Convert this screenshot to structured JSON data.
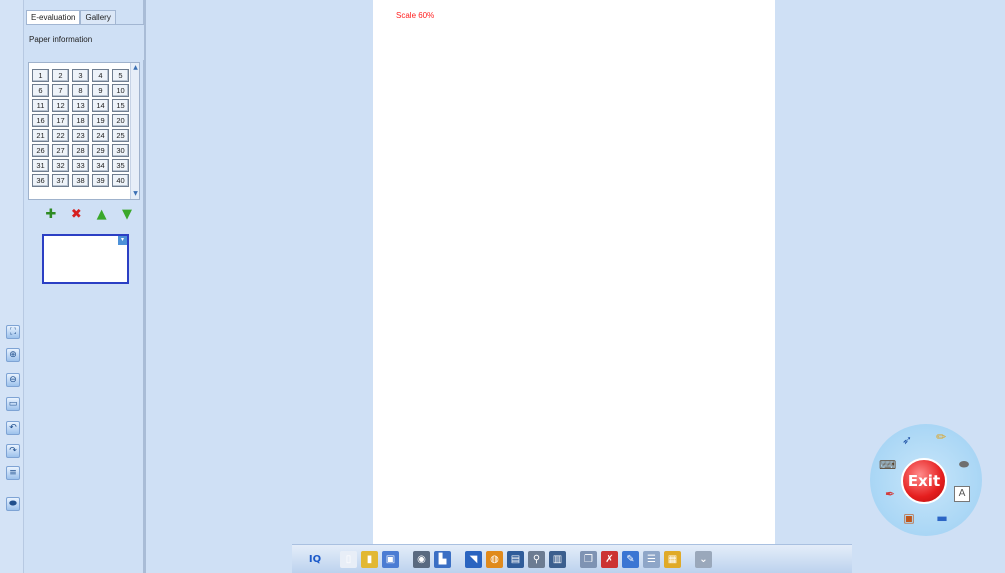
{
  "side_panel": {
    "tabs": [
      {
        "label": "E-evaluation",
        "active": true
      },
      {
        "label": "Gallery",
        "active": false
      }
    ],
    "paper_information_label": "Paper information",
    "pages": [
      "1",
      "2",
      "3",
      "4",
      "5",
      "6",
      "7",
      "8",
      "9",
      "10",
      "11",
      "12",
      "13",
      "14",
      "15",
      "16",
      "17",
      "18",
      "19",
      "20",
      "21",
      "22",
      "23",
      "24",
      "25",
      "26",
      "27",
      "28",
      "29",
      "30",
      "31",
      "32",
      "33",
      "34",
      "35",
      "36",
      "37",
      "38",
      "39",
      "40"
    ],
    "actions": [
      {
        "icon": "plus-icon",
        "name": "add-page-button",
        "glyph": "✚",
        "color": "#2e8b22"
      },
      {
        "icon": "delete-icon",
        "name": "delete-page-button",
        "glyph": "✖",
        "color": "#d62020"
      },
      {
        "icon": "arrow-up-icon",
        "name": "move-up-button",
        "glyph": "▲",
        "color": "#3aa82a"
      },
      {
        "icon": "arrow-down-icon",
        "name": "move-down-button",
        "glyph": "▼",
        "color": "#3aa82a"
      }
    ]
  },
  "canvas": {
    "scale_label": "Scale 60%"
  },
  "left_tools": [
    {
      "name": "fit-view-tool-icon",
      "glyph": "⛶"
    },
    {
      "name": "zoom-in-tool-icon",
      "glyph": "⊕"
    },
    {
      "name": "zoom-out-tool-icon",
      "glyph": "⊖"
    },
    {
      "name": "blank-page-tool-icon",
      "glyph": "▭"
    },
    {
      "name": "undo-tool-icon",
      "glyph": "↶"
    },
    {
      "name": "redo-tool-icon",
      "glyph": "↷"
    },
    {
      "name": "ruler-tool-icon",
      "glyph": "≡"
    },
    {
      "name": "eraser-tool-icon",
      "glyph": "⬬"
    }
  ],
  "bottom_toolbar": {
    "groups": [
      [
        {
          "name": "iq-logo-icon",
          "glyph": "IQ",
          "color": "#1b59c9"
        }
      ],
      [
        {
          "name": "new-page-icon",
          "glyph": "▯",
          "color": "#e8eef7"
        },
        {
          "name": "open-file-icon",
          "glyph": "▮",
          "color": "#e2b833"
        },
        {
          "name": "save-icon",
          "glyph": "▣",
          "color": "#4b7cd3"
        }
      ],
      [
        {
          "name": "camera-icon",
          "glyph": "◉",
          "color": "#5a6a80"
        },
        {
          "name": "chart-icon",
          "glyph": "▙",
          "color": "#3b6fc4"
        }
      ],
      [
        {
          "name": "spotlight-icon",
          "glyph": "◥",
          "color": "#2a64c0"
        },
        {
          "name": "browser-icon",
          "glyph": "◍",
          "color": "#e08a1c"
        },
        {
          "name": "screenshot-icon",
          "glyph": "▤",
          "color": "#2f5c9a"
        },
        {
          "name": "magnifier-icon",
          "glyph": "⚲",
          "color": "#6c7c92"
        },
        {
          "name": "screen-capture-icon",
          "glyph": "▥",
          "color": "#3c5f8e"
        }
      ],
      [
        {
          "name": "copy-icon",
          "glyph": "❐",
          "color": "#7e93b3"
        },
        {
          "name": "close-page-icon",
          "glyph": "✗",
          "color": "#cc3333"
        },
        {
          "name": "pen-tray-icon",
          "glyph": "✎",
          "color": "#3b76d3"
        },
        {
          "name": "list-icon",
          "glyph": "☰",
          "color": "#8ea6c8"
        },
        {
          "name": "gallery-icon",
          "glyph": "▦",
          "color": "#e0aa28"
        }
      ],
      [
        {
          "name": "expand-more-icon",
          "glyph": "⌄",
          "color": "#9aa8bb"
        }
      ]
    ]
  },
  "radial_menu": {
    "exit_label": "Exit",
    "items": [
      {
        "name": "select-cursor-icon",
        "glyph": "➶",
        "color": "#2456a8"
      },
      {
        "name": "pencil-icon",
        "glyph": "✏",
        "color": "#e0a21c"
      },
      {
        "name": "keyboard-icon",
        "glyph": "⌨",
        "color": "#5a4630"
      },
      {
        "name": "eraser-icon",
        "glyph": "⬬",
        "color": "#6f6f6f"
      },
      {
        "name": "highlighter-icon",
        "glyph": "✒",
        "color": "#d23c3c"
      },
      {
        "name": "text-icon",
        "glyph": "A",
        "color": "#555555"
      },
      {
        "name": "video-icon",
        "glyph": "▣",
        "color": "#c0561a"
      },
      {
        "name": "monitor-icon",
        "glyph": "▬",
        "color": "#2b65c5"
      }
    ]
  }
}
